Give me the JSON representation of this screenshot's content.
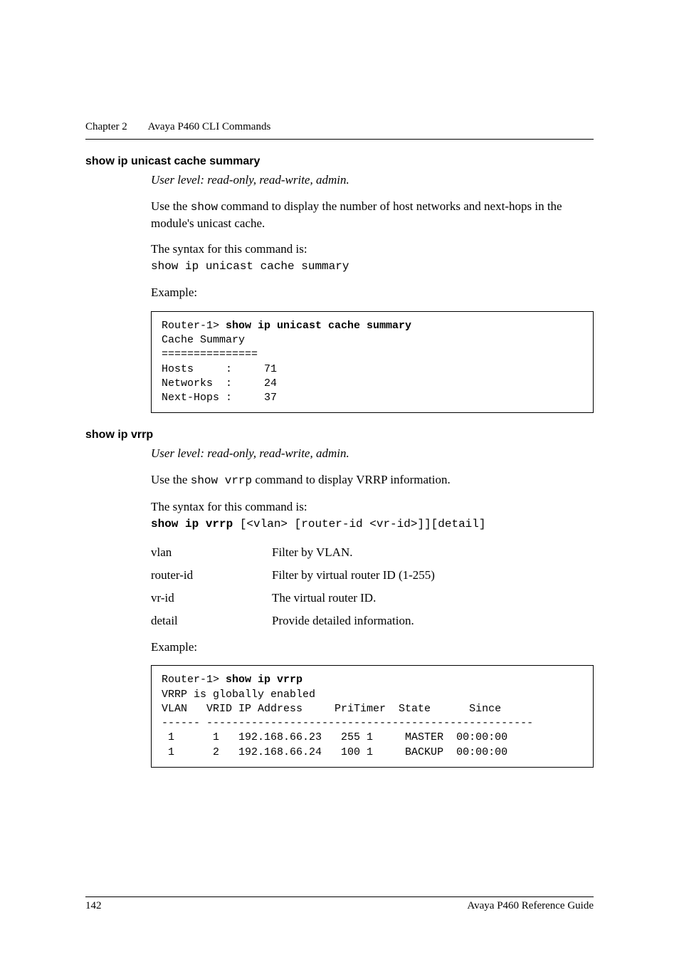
{
  "header": {
    "chapter_label": "Chapter 2",
    "chapter_title": "Avaya P460 CLI Commands"
  },
  "sections": [
    {
      "title": "show ip unicast cache summary",
      "user_level": "User level: read-only, read-write, admin.",
      "intro_pre": "Use the ",
      "intro_cmd": "show",
      "intro_post": " command to display the number of host networks and next-hops in the module's unicast cache.",
      "syntax_label": "The syntax for this command is:",
      "syntax_cmd": "show ip unicast cache summary",
      "example_label": "Example:",
      "example_prefix": "Router-1> ",
      "example_bold": "show ip unicast cache summary",
      "example_body": "Cache Summary\n===============\nHosts     :     71\nNetworks  :     24\nNext-Hops :     37"
    },
    {
      "title": "show ip vrrp",
      "user_level": "User level: read-only, read-write, admin.",
      "intro_pre": "Use the ",
      "intro_cmd": "show vrrp",
      "intro_post": " command to display VRRP information.",
      "syntax_label": "The syntax for this command is:",
      "syntax_bold": "show ip vrrp",
      "syntax_rest": " [<vlan> [router-id <vr-id>]][detail]",
      "params": [
        {
          "key": "vlan",
          "val": "Filter by VLAN."
        },
        {
          "key": "router-id",
          "val": "Filter by virtual router ID (1-255)"
        },
        {
          "key": "vr-id",
          "val": "The virtual router ID."
        },
        {
          "key": "detail",
          "val": "Provide detailed information."
        }
      ],
      "example_label": "Example:",
      "example_prefix": "Router-1> ",
      "example_bold": "show ip vrrp",
      "example_body": "VRRP is globally enabled\nVLAN   VRID IP Address     PriTimer  State      Since\n------ ---------------------------------------------------\n 1      1   192.168.66.23   255 1     MASTER  00:00:00\n 1      2   192.168.66.24   100 1     BACKUP  00:00:00"
    }
  ],
  "footer": {
    "page_number": "142",
    "doc_title": "Avaya P460 Reference Guide"
  }
}
